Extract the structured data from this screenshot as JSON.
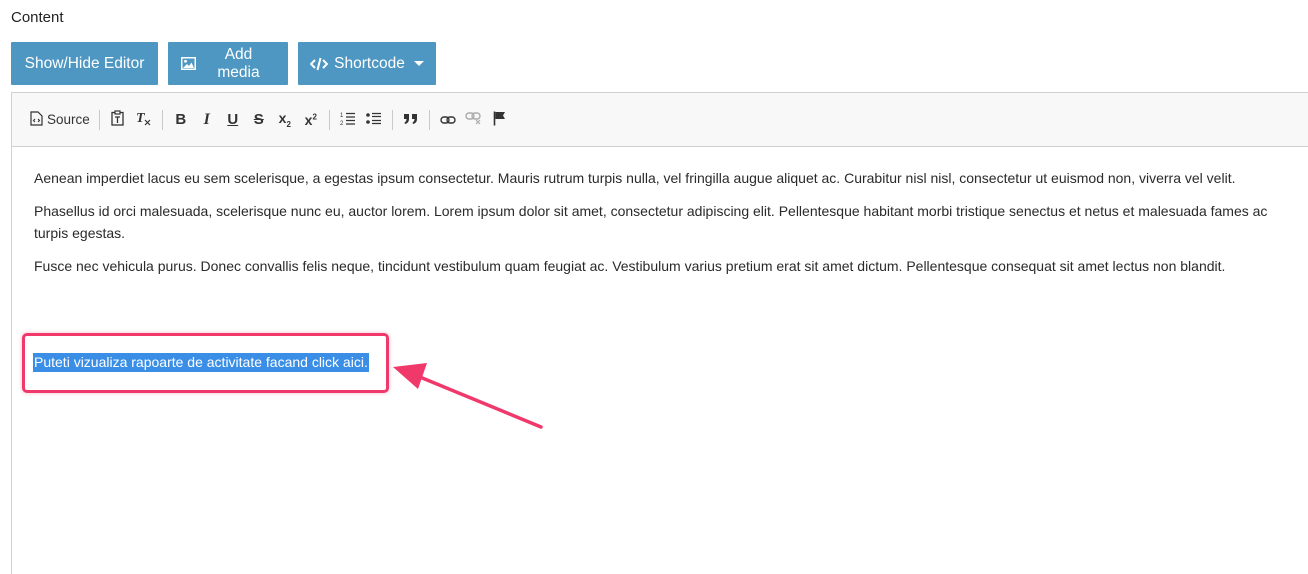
{
  "section_label": "Content",
  "action_bar": {
    "show_hide_label": "Show/Hide Editor",
    "add_media_label": "Add media",
    "shortcode_label": "Shortcode"
  },
  "toolbar": {
    "source_label": "Source"
  },
  "content": {
    "paragraphs": [
      "Aenean imperdiet lacus eu sem scelerisque, a egestas ipsum consectetur. Mauris rutrum turpis nulla, vel fringilla augue aliquet ac. Curabitur nisl nisl, consectetur ut euismod non, viverra vel velit.",
      "Phasellus id orci malesuada, scelerisque nunc eu, auctor lorem. Lorem ipsum dolor sit amet, consectetur adipiscing elit. Pellentesque habitant morbi tristique senectus et netus et malesuada fames ac turpis egestas.",
      "Fusce nec vehicula purus. Donec convallis felis neque, tincidunt vestibulum quam feugiat ac. Vestibulum varius pretium erat sit amet dictum. Pellentesque consequat sit amet lectus non blandit."
    ],
    "selected_text": "Puteti vizualiza rapoarte de activitate facand click aici."
  },
  "colors": {
    "button_bg": "#4d97c2",
    "highlight_border": "#f0386b",
    "selection_bg": "#3a8ee6"
  }
}
